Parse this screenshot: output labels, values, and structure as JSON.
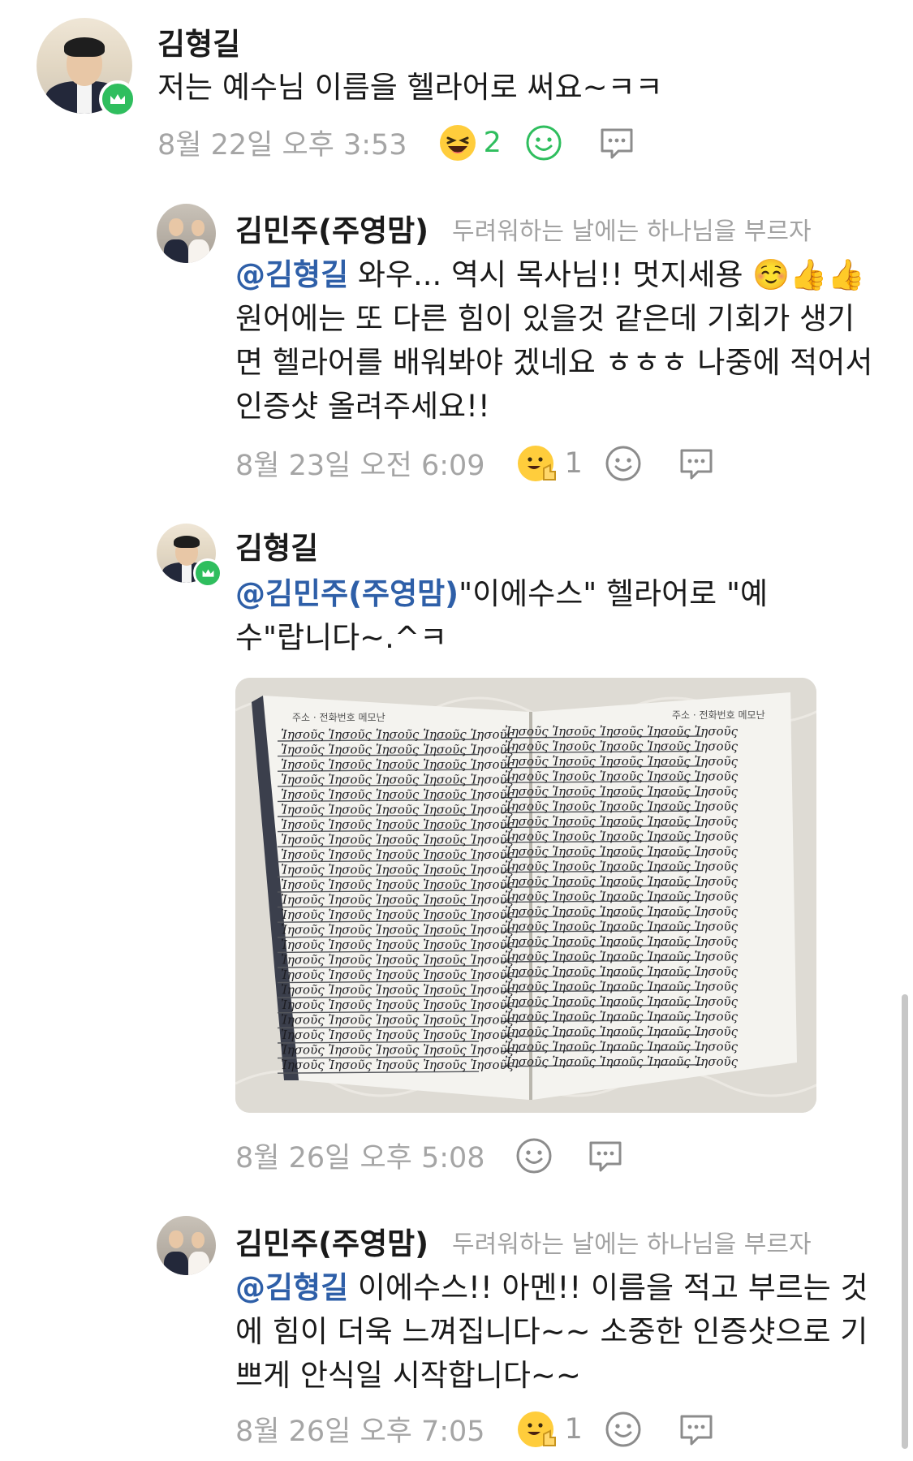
{
  "comments": [
    {
      "author": "김형길",
      "text": "저는 예수님 이름을 헬라어로 써요~ㅋㅋ",
      "time": "8월 22일 오후 3:53",
      "reaction_count": "2",
      "reaction_icon": "laughing-emoji"
    },
    {
      "author": "김민주(주영맘)",
      "tagline": "두려워하는 날에는 하나님을 부르자",
      "mention": "@김형길",
      "text": " 와우... 역시 목사님!! 멋지세용 ☺️👍👍 원어에는 또 다른 힘이 있을것 같은데 기회가 생기면 헬라어를 배워봐야 겠네요 ㅎㅎㅎ 나중에 적어서 인증샷 올려주세요!!",
      "time": "8월 23일 오전 6:09",
      "reaction_count": "1",
      "reaction_icon": "thumbs-up-emoji"
    },
    {
      "author": "김형길",
      "mention": "@김민주(주영맘)",
      "text": "\"이에수스\" 헬라어로 \"예수\"랍니다~.^ㅋ",
      "time": "8월 26일 오후 5:08",
      "photo": {
        "left_header": "주소 · 전화번호 메모난",
        "right_header": "주소 · 전화번호 메모난",
        "word": "Ἰησοῦς"
      }
    },
    {
      "author": "김민주(주영맘)",
      "tagline": "두려워하는 날에는 하나님을 부르자",
      "mention": "@김형길",
      "text": " 이에수스!! 아멘!! 이름을 적고 부르는 것에 힘이 더욱 느껴집니다~~ 소중한 인증샷으로 기쁘게 안식일 시작합니다~~",
      "time": "8월 26일 오후 7:05",
      "reaction_count": "1",
      "reaction_icon": "thumbs-up-emoji"
    }
  ],
  "colors": {
    "mention": "#2e5fa8",
    "badge_green": "#2fbe5e",
    "meta_gray": "#a5a5a5"
  }
}
